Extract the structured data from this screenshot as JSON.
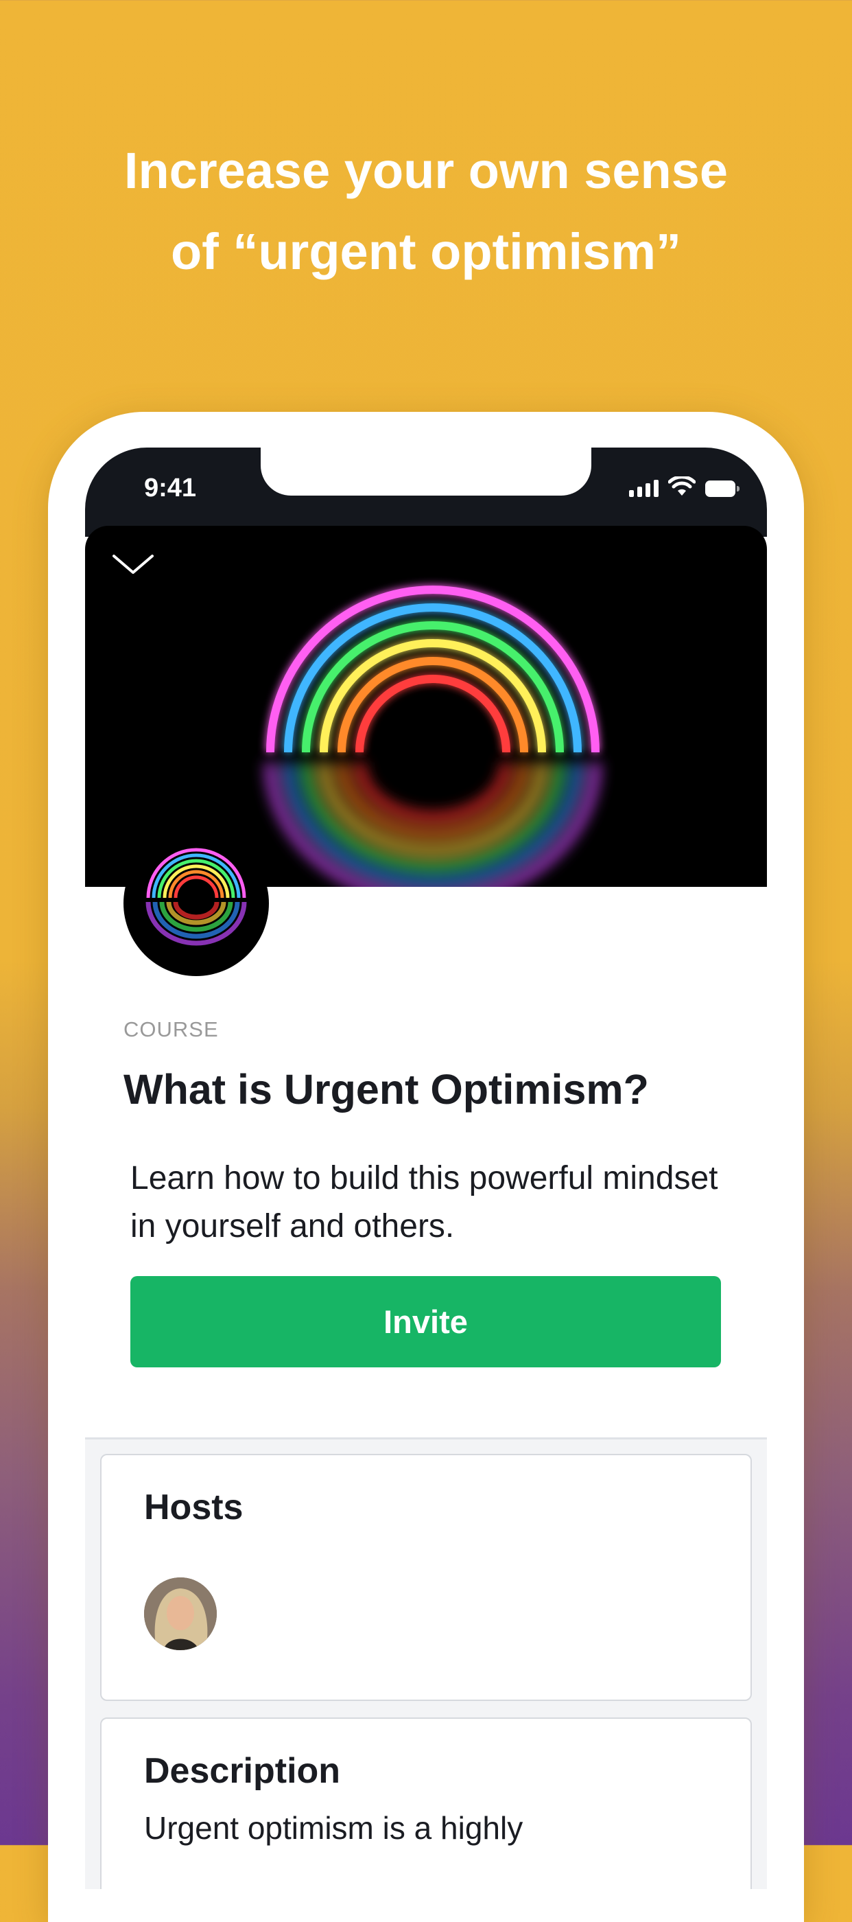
{
  "headline": {
    "line1": "Increase your own sense",
    "line2": "of “urgent optimism”"
  },
  "status_bar": {
    "time": "9:41"
  },
  "course": {
    "kicker": "COURSE",
    "title": "What is Urgent Optimism?",
    "subtitle": "Learn how to build this powerful mindset in yourself and others.",
    "invite_label": "Invite"
  },
  "hosts": {
    "heading": "Hosts"
  },
  "description": {
    "heading": "Description",
    "text": "Urgent optimism is a highly"
  },
  "colors": {
    "background_top": "#EFB537",
    "background_bottom": "#6C3890",
    "invite_button": "#17B565",
    "status_bar": "#14171d"
  },
  "icons": [
    "chevron-down-icon",
    "signal-icon",
    "wifi-icon",
    "battery-icon"
  ]
}
